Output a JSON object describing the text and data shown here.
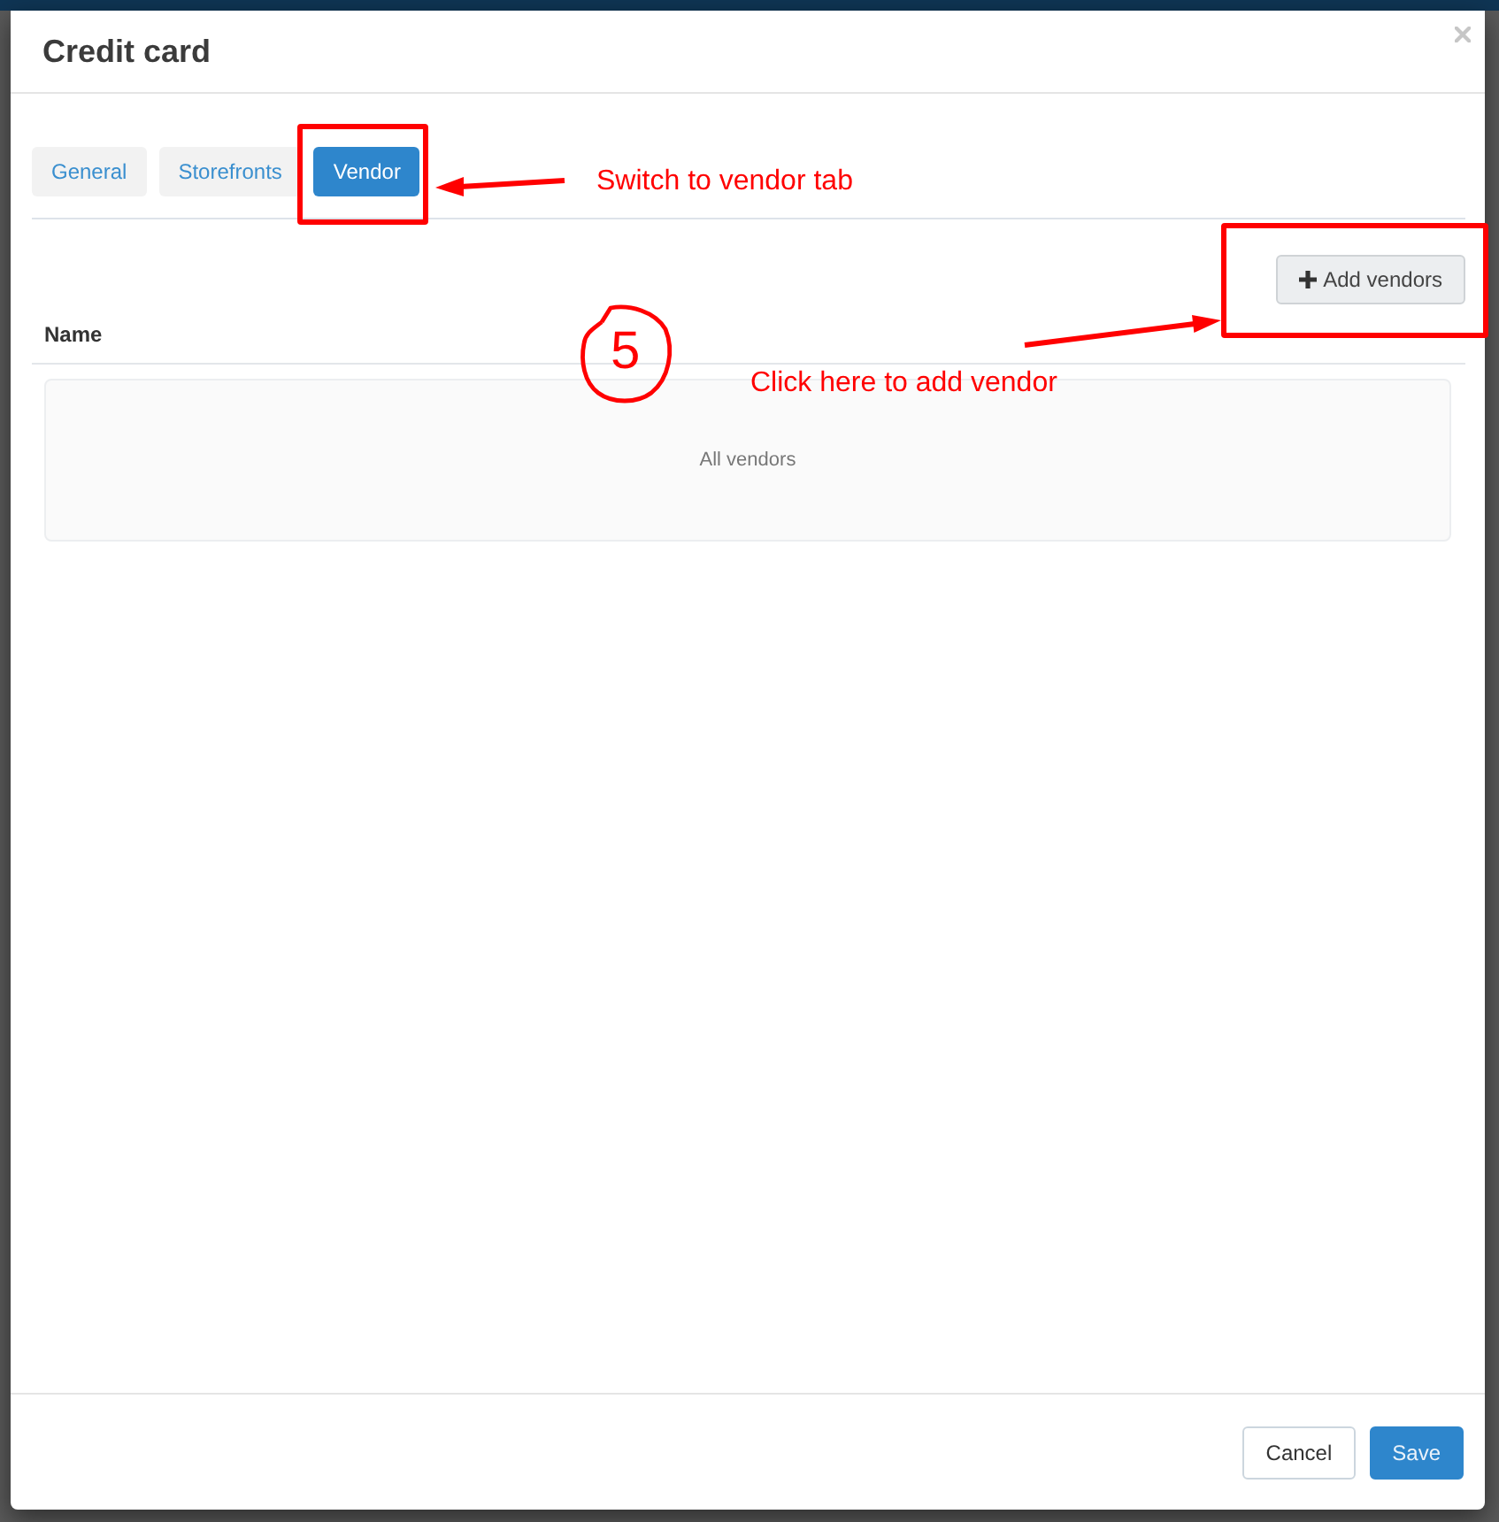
{
  "window": {
    "title": "Credit card"
  },
  "tabs": [
    {
      "label": "General",
      "selected": false
    },
    {
      "label": "Storefronts",
      "selected": false
    },
    {
      "label": "Vendor",
      "selected": true
    }
  ],
  "toolbar": {
    "button": "Add vendors"
  },
  "table": {
    "columns": [
      "Name"
    ],
    "empty_message": "All vendors"
  },
  "footer": {
    "buttons": [
      {
        "label": "Cancel",
        "kind": "secondary"
      },
      {
        "label": "Save",
        "kind": "primary"
      }
    ]
  },
  "annotations": {
    "step": "5",
    "notes": [
      {
        "text": "Switch to vendor tab"
      },
      {
        "text": "Click here to add vendor"
      }
    ]
  }
}
